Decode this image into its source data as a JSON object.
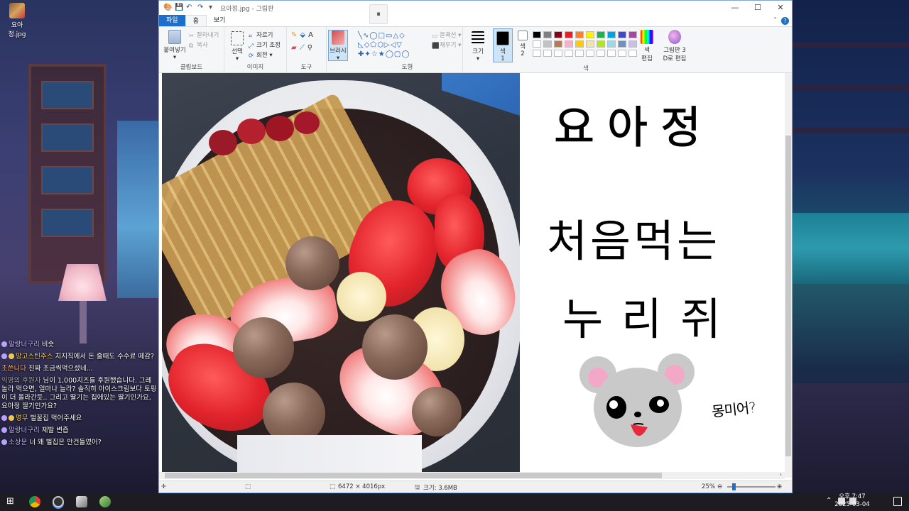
{
  "desktop": {
    "icon_label": "요아정.jpg"
  },
  "chat": [
    {
      "badge": "p",
      "name": "말랑너구리",
      "name_class": "",
      "text": "비숏"
    },
    {
      "badge": "y",
      "name": "망고스틴주스",
      "name_class": "y",
      "text": "치지직에서 돈 줄때도 수수료 떼감?"
    },
    {
      "badge": "",
      "name": "초쓴니다",
      "name_class": "o",
      "text": "진짜 조금씩먹으셨네..."
    },
    {
      "badge": "",
      "name": "익명의 후원자",
      "name_class": "g",
      "text": "님이 1,000치즈를 후원했습니다. 그레놀라 먹으면, 얼마나 늘라? 솔직히 아이스크림보다 토핑이 더 올라간듯.. 그리고 딸기는 집에있는 딸기인가요, 요아정 딸기인가요?"
    },
    {
      "badge": "y",
      "name": "명무",
      "name_class": "o",
      "text": "벌꿀집 먹어주세요"
    },
    {
      "badge": "p",
      "name": "말랑너구리",
      "name_class": "",
      "text": "제발 변즙"
    },
    {
      "badge": "p",
      "name": "소상문",
      "name_class": "",
      "text": "너 왜 벌집은 안건들였어?"
    }
  ],
  "paint": {
    "title": "요아정.jpg - 그림판",
    "pause_label": "⏸",
    "win_controls": {
      "minimize": "—",
      "maximize": "☐",
      "close": "✕"
    },
    "tabs": {
      "file": "파일",
      "home": "홈",
      "view": "보기"
    },
    "help": "?",
    "ribbon": {
      "clipboard": {
        "paste": "붙여넣기",
        "cut": "잘라내기",
        "copy": "복사",
        "label": "클립보드"
      },
      "image": {
        "select": "선택",
        "crop": "자르기",
        "resize": "크기 조정",
        "rotate": "회전",
        "label": "이미지"
      },
      "tools": {
        "label": "도구"
      },
      "brush": {
        "label": "브러시"
      },
      "shapes": {
        "outline": "윤곽선",
        "fill": "채우기",
        "label": "도형"
      },
      "size": {
        "label": "크기"
      },
      "color1": {
        "label": "색\n1"
      },
      "color2": {
        "label": "색\n2"
      },
      "colors": {
        "label": "색"
      },
      "edit_colors": {
        "label": "색\n편집"
      },
      "paint3d": {
        "label": "그림판 3\nD로 편집"
      }
    },
    "palette": [
      "#000000",
      "#7f7f7f",
      "#880015",
      "#ed1c24",
      "#ff7f27",
      "#fff200",
      "#22b14c",
      "#00a2e8",
      "#3f48cc",
      "#a349a4",
      "#ffffff",
      "#c3c3c3",
      "#b97a57",
      "#ffaec9",
      "#ffc90e",
      "#efe4b0",
      "#b5e61d",
      "#99d9ea",
      "#7092be",
      "#c8bfe7",
      "#ffffff",
      "#ffffff",
      "#ffffff",
      "#ffffff",
      "#ffffff",
      "#ffffff",
      "#ffffff",
      "#ffffff",
      "#ffffff",
      "#ffffff"
    ],
    "canvas_text": {
      "line1": "요아정",
      "line2": "처음먹는",
      "line3": "누리쥐",
      "note": "몽미어?"
    },
    "status": {
      "dimensions": "6472 × 4016px",
      "size": "크기: 3.6MB",
      "zoom": "25%"
    }
  },
  "taskbar": {
    "time": "오후 7:47",
    "date": "2025-03-04"
  }
}
